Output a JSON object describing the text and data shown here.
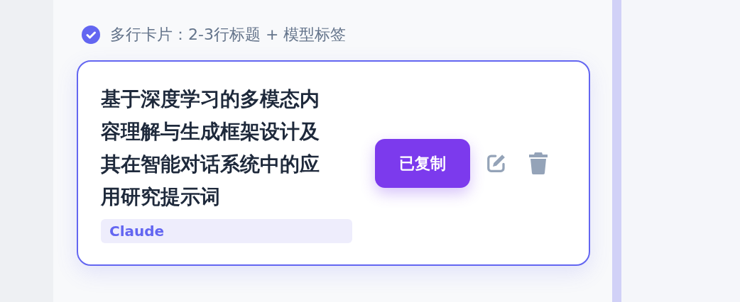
{
  "option": {
    "label": "多行卡片：2-3行标题 + 模型标签",
    "checked": true
  },
  "card": {
    "title": "基于深度学习的多模态内容理解与生成框架设计及其在智能对话系统中的应用研究提示词",
    "tag": "Claude",
    "selected": true,
    "copy_button": {
      "label": "已复制"
    }
  }
}
